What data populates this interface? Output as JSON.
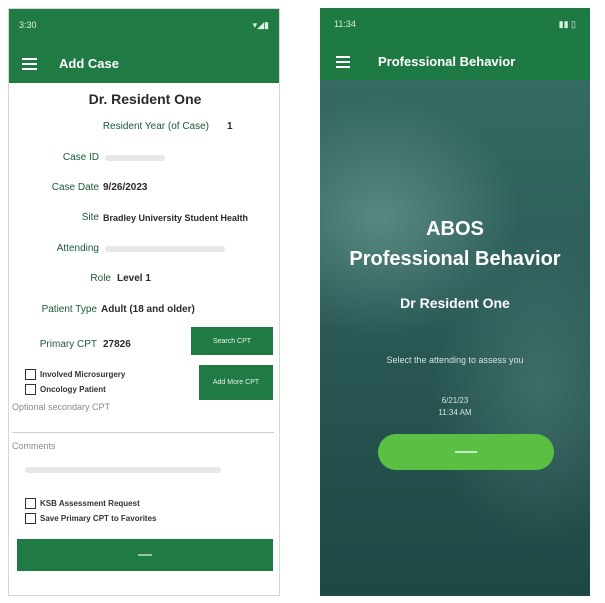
{
  "left": {
    "status": {
      "time": "3:30",
      "right": "▾◢▮"
    },
    "appbar": {
      "title": "Add Case"
    },
    "resident_name": "Dr. Resident One",
    "fields": {
      "resident_year_label": "Resident Year (of Case)",
      "resident_year_value": "1",
      "case_id_label": "Case ID",
      "case_date_label": "Case Date",
      "case_date_value": "9/26/2023",
      "site_label": "Site",
      "site_value": "Bradley University Student Health",
      "attending_label": "Attending",
      "role_label": "Role",
      "role_value": "Level 1",
      "patient_type_label": "Patient Type",
      "patient_type_value": "Adult (18 and older)",
      "primary_cpt_label": "Primary CPT",
      "primary_cpt_value": "27826"
    },
    "buttons": {
      "search_cpt": "Search CPT",
      "add_more_cpt": "Add More CPT"
    },
    "checks": {
      "microsurgery": "Involved Microsurgery",
      "oncology": "Oncology Patient",
      "ksb": "KSB Assessment Request",
      "favorites": "Save Primary CPT to Favorites"
    },
    "optional_secondary_label": "Optional secondary CPT",
    "comments_label": "Comments"
  },
  "right": {
    "status": {
      "time": "11:34",
      "right": "▮▮ ▯"
    },
    "appbar": {
      "title": "Professional Behavior"
    },
    "heading1": "ABOS",
    "heading2": "Professional Behavior",
    "resident_name": "Dr Resident One",
    "instruction": "Select the attending to assess you",
    "date": "6/21/23",
    "time": "11:34 AM"
  }
}
